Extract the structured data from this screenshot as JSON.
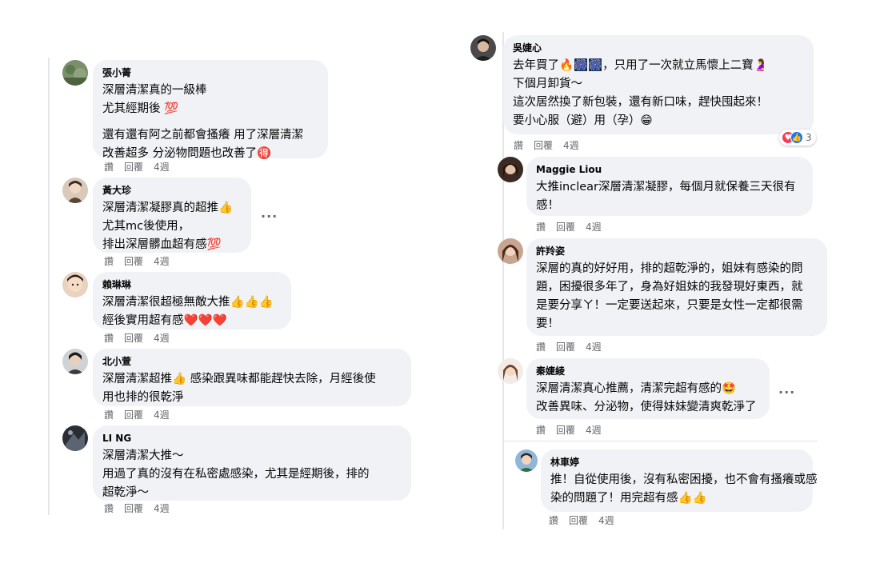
{
  "common": {
    "reply_label": "讚",
    "reply2_label": "回覆",
    "time_label": "4週"
  },
  "left_comments": [
    {
      "name": "張小菁",
      "lines": [
        "深層清潔真的一級棒",
        "尤其經期後 💯",
        "",
        "還有還有阿之前都會搔癢 用了深層清潔",
        "改善超多 分泌物問題也改善了🉐"
      ]
    },
    {
      "name": "黃大珍",
      "lines": [
        "深層清潔凝膠真的超推👍",
        "尤其mc後使用，",
        "排出深層髒血超有感💯"
      ]
    },
    {
      "name": "賴琳琳",
      "lines": [
        "深層清潔很超極無敵大推👍👍👍",
        "經後實用超有感❤️❤️❤️"
      ]
    },
    {
      "name": "北小萱",
      "lines": [
        "深層清潔超推👍 感染跟異味都能趕快去除，月經後使",
        "用也排的很乾淨"
      ]
    },
    {
      "name": "LI NG",
      "lines": [
        "深層清潔大推～",
        "用過了真的沒有在私密處感染，尤其是經期後，排的",
        "超乾淨～"
      ]
    }
  ],
  "right_comments": [
    {
      "name": "吳婕心",
      "lines": [
        "去年買了🔥🎆🎆，只用了一次就立馬懷上二寶🤰",
        "下個月卸貨～",
        "這次居然換了新包裝，還有新口味，趕快囤起來！",
        "要小心服（避）用（孕）😁"
      ],
      "reaction_count": "3"
    },
    {
      "name": "Maggie Liou",
      "lines": [
        "大推inclear深層清潔凝膠，每個月就保養三天很有",
        "感！"
      ]
    },
    {
      "name": "許羚姿",
      "lines": [
        "深層的真的好好用，排的超乾淨的，姐妹有感染的問",
        "題，困擾很多年了，身為好姐妹的我發現好東西，就",
        "是要分享ㄚ！一定要送起來，只要是女性一定都很需",
        "要！"
      ]
    },
    {
      "name": "秦婕綾",
      "lines": [
        "深層清潔真心推薦，清潔完超有感的🤩",
        "改善異味、分泌物，使得妹妹變清爽乾淨了"
      ]
    },
    {
      "name": "林車婷",
      "lines": [
        "推！自從使用後，沒有私密困擾，也不會有搔癢或感",
        "染的問題了！用完超有感👍👍"
      ]
    }
  ],
  "colors": {
    "bubble": "#f0f2f5",
    "meta": "#65676b",
    "love": "#f33e58",
    "like": "#1877f2"
  }
}
